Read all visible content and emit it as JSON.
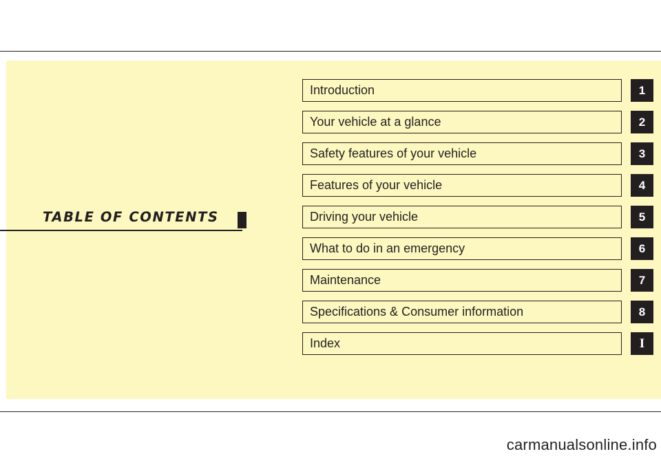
{
  "document": {
    "title": "TABLE  OF  CONTENTS",
    "watermark": "carmanualsonline.info",
    "accent_color": "#231f20",
    "panel_color": "#fcf8bf"
  },
  "contents": [
    {
      "label": "Introduction",
      "tab": "1"
    },
    {
      "label": "Your vehicle at a glance",
      "tab": "2"
    },
    {
      "label": "Safety features of your vehicle",
      "tab": "3"
    },
    {
      "label": "Features of your vehicle",
      "tab": "4"
    },
    {
      "label": "Driving your vehicle",
      "tab": "5"
    },
    {
      "label": "What to do in an emergency",
      "tab": "6"
    },
    {
      "label": "Maintenance",
      "tab": "7"
    },
    {
      "label": "Specifications & Consumer information",
      "tab": "8"
    },
    {
      "label": "Index",
      "tab": "I"
    }
  ]
}
